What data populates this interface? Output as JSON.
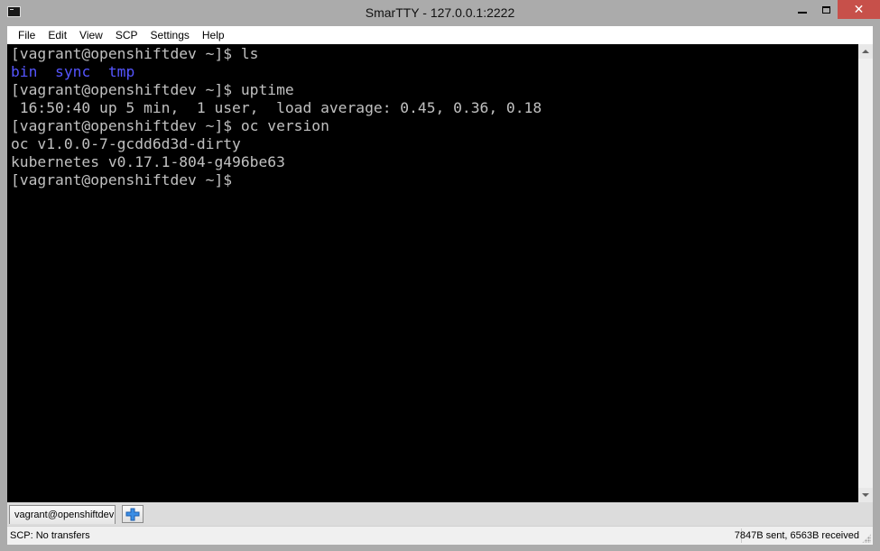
{
  "window": {
    "title": "SmarTTY - 127.0.0.1:2222",
    "close_glyph": "✕"
  },
  "menu": [
    "File",
    "Edit",
    "View",
    "SCP",
    "Settings",
    "Help"
  ],
  "terminal": {
    "lines": [
      {
        "text": "[vagrant@openshiftdev ~]$ ls"
      },
      {
        "text": "bin  sync  tmp",
        "dirs": true
      },
      {
        "text": "[vagrant@openshiftdev ~]$ uptime"
      },
      {
        "text": " 16:50:40 up 5 min,  1 user,  load average: 0.45, 0.36, 0.18"
      },
      {
        "text": "[vagrant@openshiftdev ~]$ oc version"
      },
      {
        "text": "oc v1.0.0-7-gcdd6d3d-dirty"
      },
      {
        "text": "kubernetes v0.17.1-804-g496be63"
      },
      {
        "text": "[vagrant@openshiftdev ~]$"
      }
    ],
    "dirs": [
      "bin",
      "sync",
      "tmp"
    ]
  },
  "tabs": {
    "session_label": "vagrant@openshiftdev:~",
    "new_tab_icon": "plus-icon"
  },
  "status": {
    "left": "SCP: No transfers",
    "right": "7847B sent, 6563B received"
  },
  "colors": {
    "terminal_bg": "#000000",
    "terminal_fg": "#c0c0c0",
    "directory": "#5555ff",
    "close_button": "#c7504a",
    "chrome": "#ababab"
  }
}
